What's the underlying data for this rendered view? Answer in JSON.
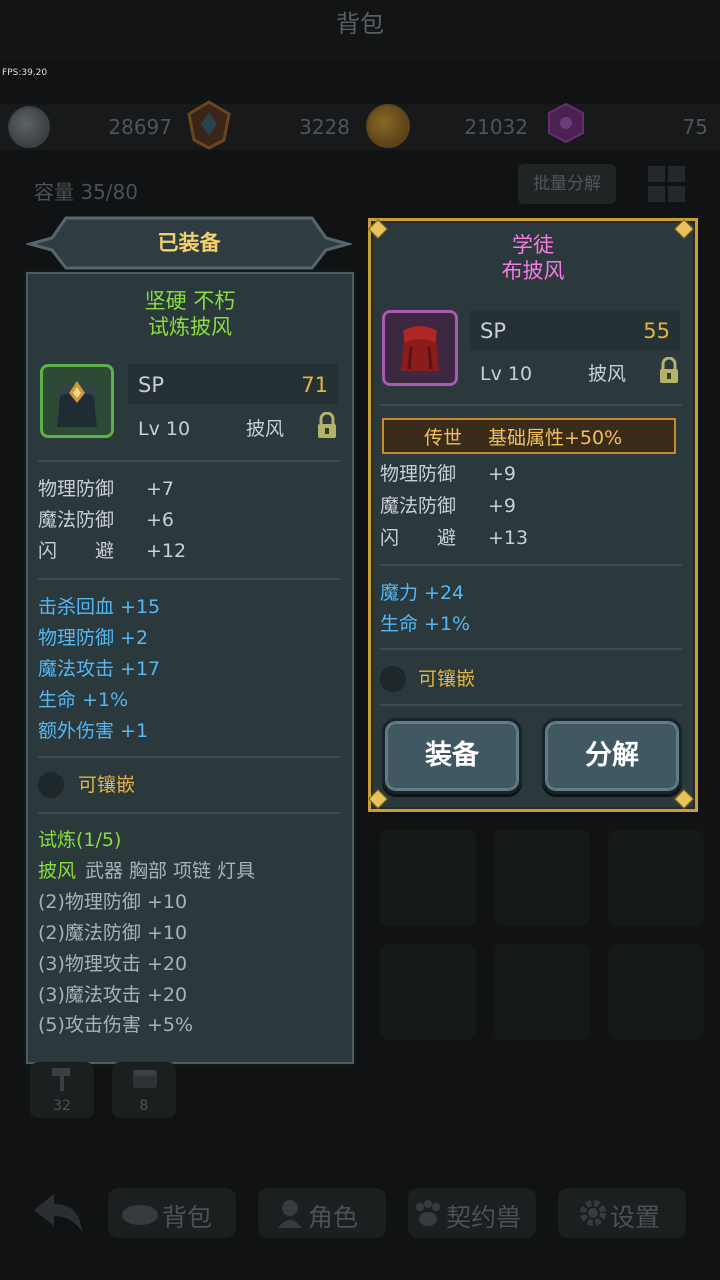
{
  "header": {
    "title": "背包",
    "fps": "FPS:39.20"
  },
  "currencies": [
    {
      "icon": "silver-coin-icon",
      "value": "28697"
    },
    {
      "icon": "rank-crest-icon",
      "value": "3228"
    },
    {
      "icon": "gold-coin-icon",
      "value": "21032"
    },
    {
      "icon": "purple-gem-icon",
      "value": "75"
    }
  ],
  "inventory": {
    "capacity": "容量 35/80",
    "batch_label": "批量分解"
  },
  "equipped": {
    "header": "已装备",
    "name_line1": "坚硬 不朽",
    "name_line2": "试炼披风",
    "sp_label": "SP",
    "sp_value": "71",
    "level": "Lv 10",
    "slot": "披风",
    "base_stats": [
      {
        "name": "物理防御",
        "value": "+7"
      },
      {
        "name": "魔法防御",
        "value": "+6"
      },
      {
        "name": "闪　　避",
        "value": "+12"
      }
    ],
    "extra_stats": [
      "击杀回血 +15",
      "物理防御 +2",
      "魔法攻击 +17",
      "生命 +1%",
      "额外伤害 +1"
    ],
    "socket": "可镶嵌",
    "set_title": "试炼(1/5)",
    "set_active": "披风",
    "set_parts": "武器 胸部 项链 灯具",
    "set_bonuses": [
      "(2)物理防御 +10",
      "(2)魔法防御 +10",
      "(3)物理攻击 +20",
      "(3)魔法攻击 +20",
      "(5)攻击伤害 +5%"
    ]
  },
  "selected": {
    "name_line1": "学徒",
    "name_line2": "布披风",
    "sp_label": "SP",
    "sp_value": "55",
    "level": "Lv 10",
    "slot": "披风",
    "legend_tag": "传世",
    "legend_text": "基础属性+50%",
    "base_stats": [
      {
        "name": "物理防御",
        "value": "+9"
      },
      {
        "name": "魔法防御",
        "value": "+9"
      },
      {
        "name": "闪　　避",
        "value": "+13"
      }
    ],
    "extra_stats": [
      "魔力 +24",
      "生命 +1%"
    ],
    "socket": "可镶嵌",
    "equip_label": "装备",
    "dismantle_label": "分解"
  },
  "stacks": [
    {
      "icon": "hammer-icon",
      "count": "32"
    },
    {
      "icon": "chest-icon",
      "count": "8"
    }
  ],
  "nav": {
    "back_icon": "back-arrow-icon",
    "items": [
      {
        "label": "背包",
        "icon": "bag-icon"
      },
      {
        "label": "角色",
        "icon": "character-icon"
      },
      {
        "label": "契约兽",
        "icon": "paw-icon"
      },
      {
        "label": "设置",
        "icon": "gear-icon"
      }
    ]
  },
  "colors": {
    "gold_border": "#c79f38",
    "green_name": "#89dd3f",
    "pink_name": "#f47ce0",
    "blue_stat": "#56b7f3",
    "legend_bg": "#3a2b1b"
  }
}
